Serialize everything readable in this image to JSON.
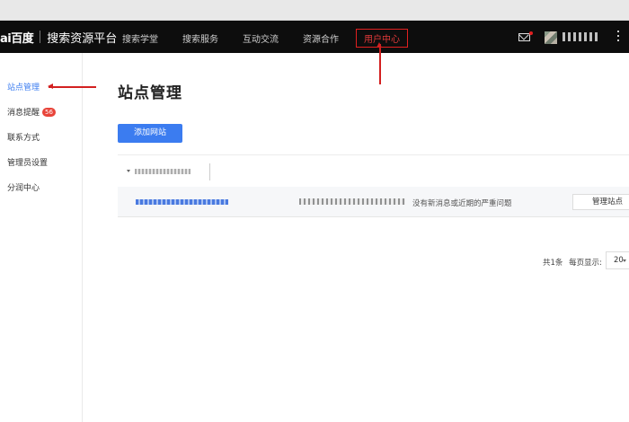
{
  "header": {
    "logo_mark": "ai百度",
    "brand_title": "搜索资源平台",
    "nav": [
      "搜索学堂",
      "搜索服务",
      "互动交流",
      "资源合作",
      "用户中心"
    ]
  },
  "sidebar": {
    "items": [
      {
        "label": "站点管理",
        "active": true
      },
      {
        "label": "消息提醒",
        "badge": "56"
      },
      {
        "label": "联系方式"
      },
      {
        "label": "管理员设置"
      },
      {
        "label": "分润中心"
      }
    ]
  },
  "main": {
    "title": "站点管理",
    "add_button": "添加网站",
    "site_row": {
      "status_text": "没有新消息或近期的严重问题",
      "manage_button": "管理站点"
    },
    "pagination": {
      "total_text": "共1条",
      "per_page_label": "每页显示:",
      "per_page_value": "20"
    }
  },
  "colors": {
    "accent_blue": "#3b7cf0",
    "annotation_red": "#d32020",
    "navbar_bg": "#0d0d0d",
    "badge_red": "#e8443a"
  }
}
